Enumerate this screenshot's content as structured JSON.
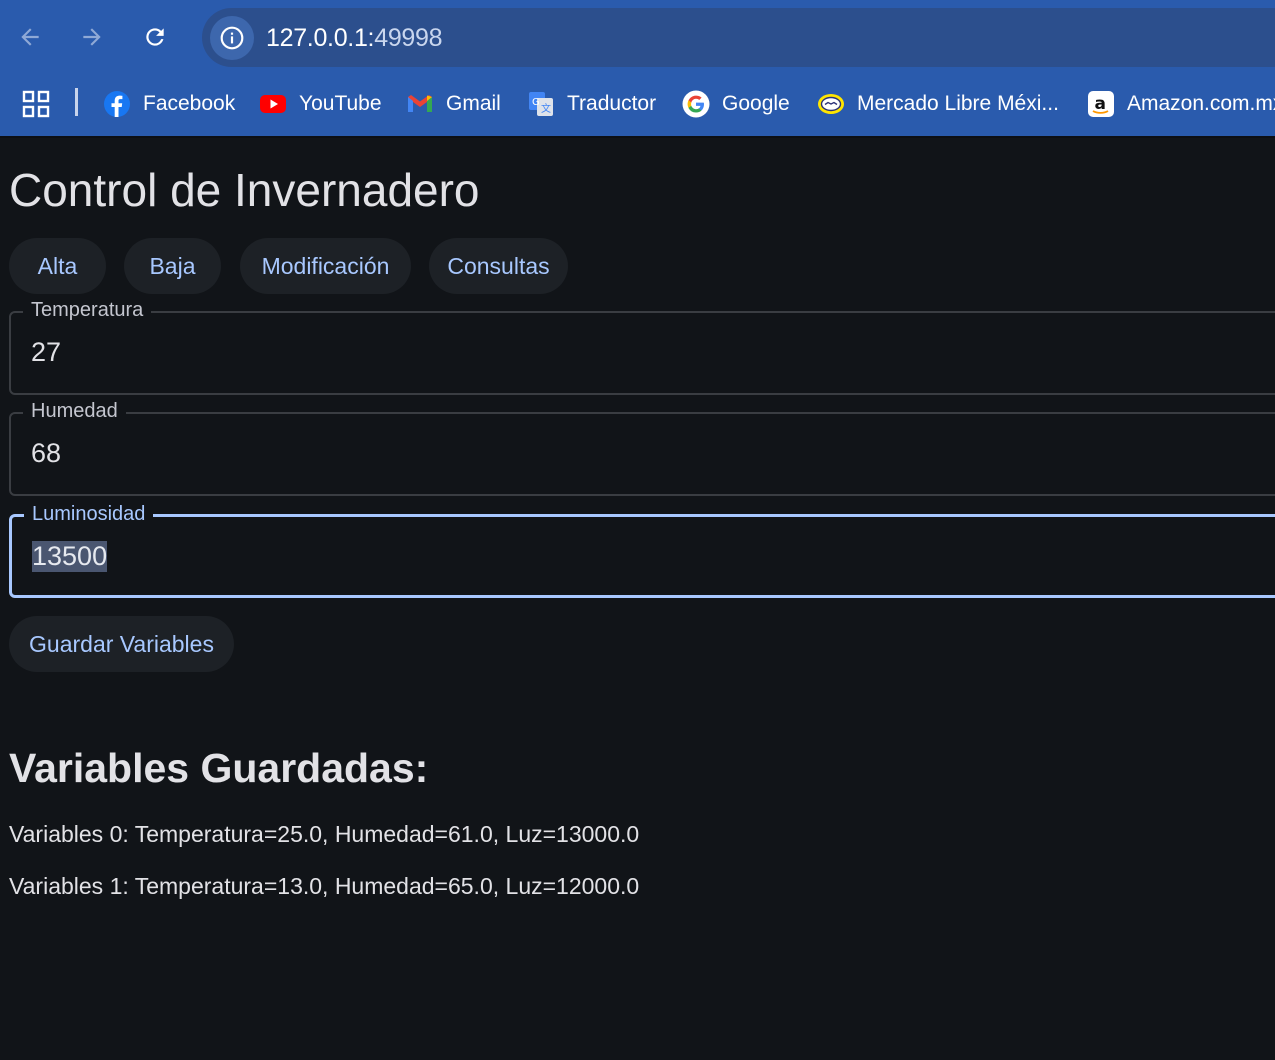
{
  "browser": {
    "url_host": "127.0.0.1:",
    "url_port": "49998",
    "bookmarks": [
      {
        "label": "Facebook",
        "icon": "facebook-icon"
      },
      {
        "label": "YouTube",
        "icon": "youtube-icon"
      },
      {
        "label": "Gmail",
        "icon": "gmail-icon"
      },
      {
        "label": "Traductor",
        "icon": "translate-icon"
      },
      {
        "label": "Google",
        "icon": "google-icon"
      },
      {
        "label": "Mercado Libre Méxi...",
        "icon": "mercadolibre-icon"
      },
      {
        "label": "Amazon.com.mx",
        "icon": "amazon-icon"
      }
    ]
  },
  "app": {
    "title": "Control de Invernadero",
    "tabs": [
      {
        "label": "Alta"
      },
      {
        "label": "Baja"
      },
      {
        "label": "Modificación"
      },
      {
        "label": "Consultas"
      }
    ],
    "fields": {
      "temperatura": {
        "label": "Temperatura",
        "value": "27"
      },
      "humedad": {
        "label": "Humedad",
        "value": "68"
      },
      "luminosidad": {
        "label": "Luminosidad",
        "value": "13500"
      }
    },
    "save_label": "Guardar Variables",
    "saved_title": "Variables Guardadas:",
    "saved": [
      "Variables 0: Temperatura=25.0, Humedad=61.0, Luz=13000.0",
      "Variables 1: Temperatura=13.0, Humedad=65.0, Luz=12000.0"
    ]
  },
  "colors": {
    "chrome": "#2a5bad",
    "background": "#111418",
    "accent": "#a8c8ff"
  }
}
